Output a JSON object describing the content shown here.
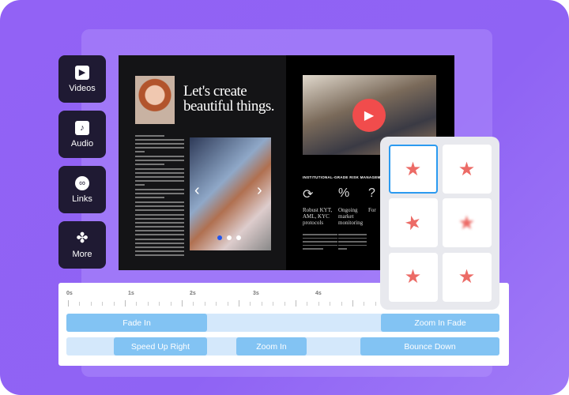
{
  "sidebar": {
    "items": [
      {
        "label": "Videos",
        "icon": "video-clapper-icon"
      },
      {
        "label": "Audio",
        "icon": "music-note-icon"
      },
      {
        "label": "Links",
        "icon": "link-icon"
      },
      {
        "label": "More",
        "icon": "grid-icon"
      }
    ]
  },
  "document": {
    "headline_line1": "Let's create",
    "headline_line2": "beautiful things.",
    "section_title": "INSTITUTIONAL-GRADE RISK MANAGEMENT PROCESSES",
    "features": [
      {
        "title": "Robust KYT, AML, KYC protocols"
      },
      {
        "title": "Ongoing market monitoring"
      },
      {
        "title": "For"
      }
    ],
    "carousel_active": 1,
    "carousel_count": 3
  },
  "animations": {
    "options": [
      "zoom-in-fade",
      "zoom-in",
      "spin",
      "blur",
      "slide-left",
      "slide-right"
    ],
    "selected": 0,
    "accent": "#2b9af0",
    "star_color": "#ec6b66"
  },
  "timeline": {
    "ruler": [
      "0s",
      "1s",
      "2s",
      "3s",
      "4s"
    ],
    "track1": [
      {
        "label": "Fade In"
      },
      {
        "label": "Zoom In Fade"
      }
    ],
    "track2": [
      {
        "label": "Speed Up Right"
      },
      {
        "label": "Zoom In"
      },
      {
        "label": "Bounce Down"
      }
    ],
    "clip_color": "#82c3f3",
    "track_color": "#d4e8fb"
  }
}
